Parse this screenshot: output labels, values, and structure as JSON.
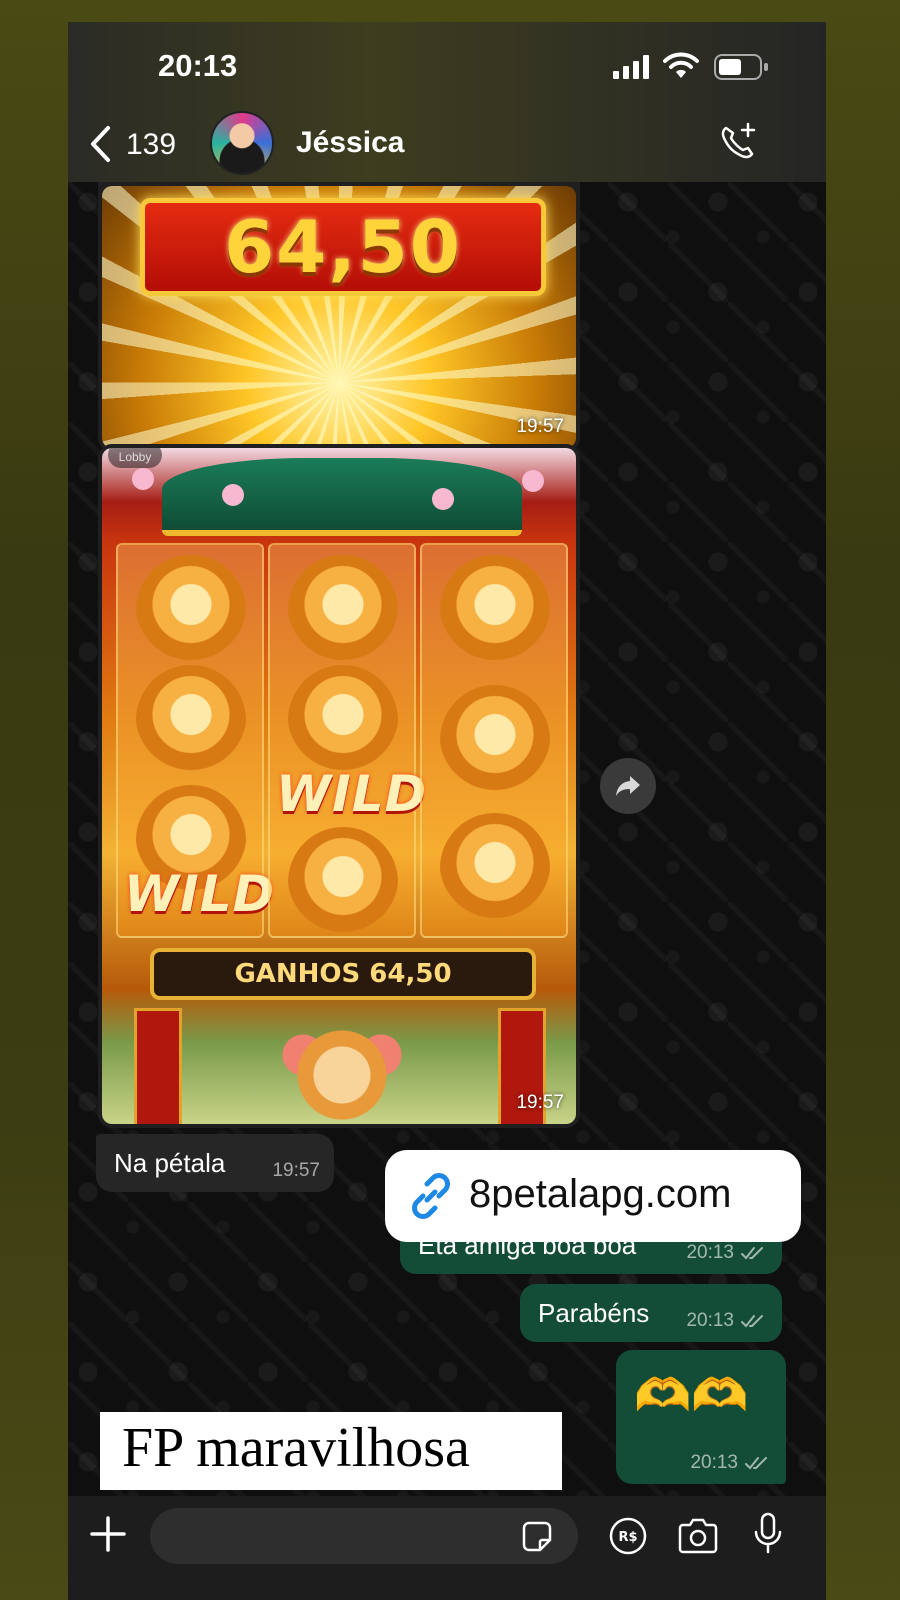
{
  "status_bar": {
    "time": "20:13"
  },
  "header": {
    "back_count": "139",
    "contact_name": "Jéssica"
  },
  "messages": {
    "image1": {
      "amount": "64,50",
      "time": "19:57"
    },
    "image2": {
      "wild_label": "WILD",
      "win_label": "GANHOS 64,50",
      "time": "19:57",
      "lobby": "Lobby"
    },
    "text1": {
      "text": "Na pétala",
      "time": "19:57"
    },
    "text2": {
      "text": "Eta amiga boa boa",
      "time": "20:13"
    },
    "text3": {
      "text": "Parabéns",
      "time": "20:13"
    },
    "text4": {
      "emoji": "🫶🫶",
      "time": "20:13"
    }
  },
  "overlays": {
    "link_text": "8petalapg.com",
    "caption": "FP maravilhosa"
  },
  "input_bar": {
    "placeholder": ""
  },
  "colors": {
    "outgoing_bubble": "#144d37",
    "incoming_bubble": "#262626",
    "link_blue": "#1e88e5"
  }
}
